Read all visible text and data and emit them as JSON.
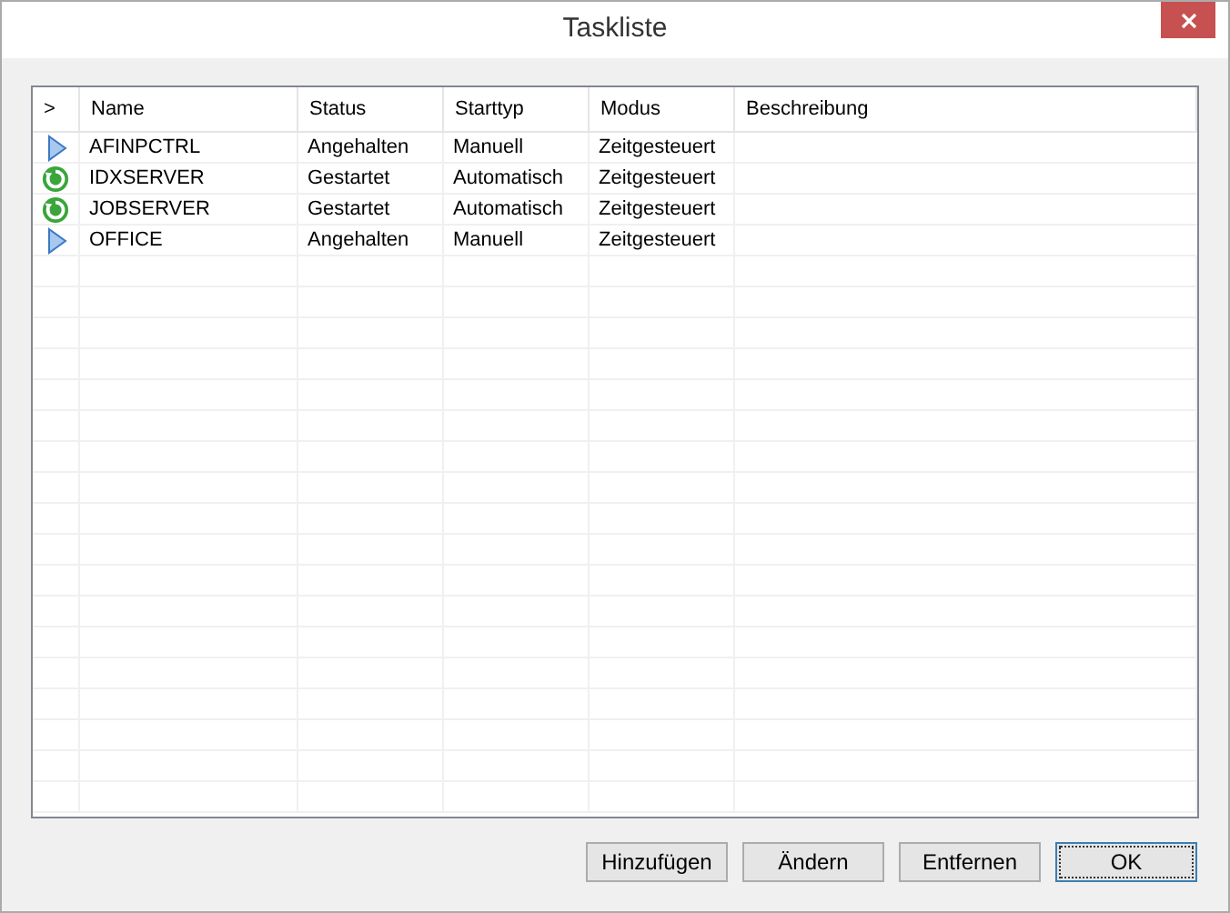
{
  "window": {
    "title": "Taskliste"
  },
  "table": {
    "columns": [
      ">",
      "Name",
      "Status",
      "Starttyp",
      "Modus",
      "Beschreibung"
    ],
    "rows": [
      {
        "kind": "stopped",
        "cells": [
          "",
          "AFINPCTRL",
          "Angehalten",
          "Manuell",
          "Zeitgesteuert"
        ]
      },
      {
        "kind": "started",
        "cells": [
          "",
          "IDXSERVER",
          "Gestartet",
          "Automatisch",
          "Zeitgesteuert"
        ]
      },
      {
        "kind": "started",
        "cells": [
          "",
          "JOBSERVER",
          "Gestartet",
          "Automatisch",
          "Zeitgesteuert"
        ]
      },
      {
        "kind": "stopped",
        "cells": [
          "",
          "OFFICE",
          "Angehalten",
          "Manuell",
          "Zeitgesteuert"
        ]
      }
    ]
  },
  "buttons": [
    {
      "label": "Hinzufügen",
      "default": false
    },
    {
      "label": "Ändern",
      "default": false
    },
    {
      "label": "Entfernen",
      "default": false
    },
    {
      "label": "OK",
      "default": true
    }
  ]
}
